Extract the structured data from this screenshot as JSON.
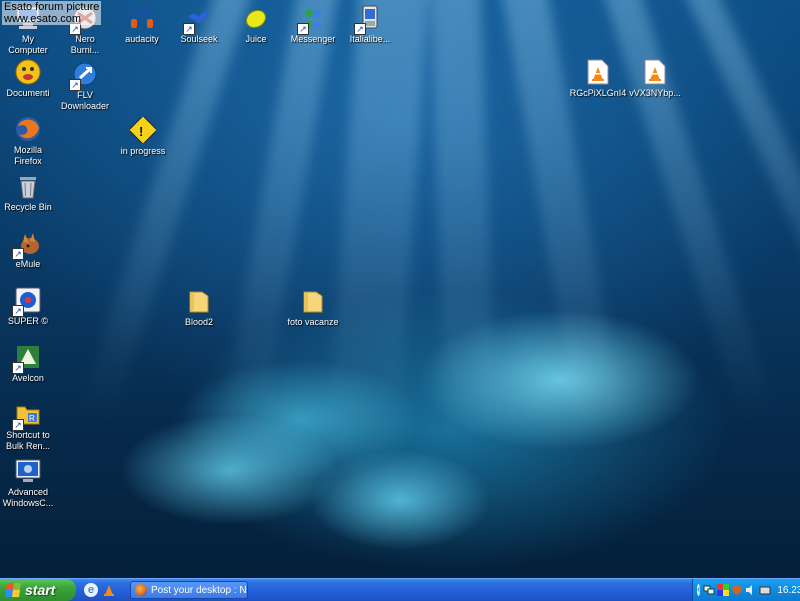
{
  "watermark": {
    "line1": "Esato forum picture",
    "line2": "www.esato.com"
  },
  "desktop_icons": [
    {
      "id": "my-computer",
      "label": "My\nComputer",
      "icon": "computer-icon"
    },
    {
      "id": "nero",
      "label": "Nero\nBurni...",
      "icon": "nero-icon"
    },
    {
      "id": "audacity",
      "label": "audacity",
      "icon": "headphones-icon"
    },
    {
      "id": "soulseek",
      "label": "Soulseek",
      "icon": "bird-icon"
    },
    {
      "id": "juice",
      "label": "Juice",
      "icon": "lemon-icon"
    },
    {
      "id": "messenger",
      "label": "Messenger",
      "icon": "messenger-people-icon"
    },
    {
      "id": "italialibera",
      "label": "Italialibe...",
      "icon": "italialibera-icon"
    },
    {
      "id": "documenti",
      "label": "Documenti",
      "icon": "smiley-face-icon"
    },
    {
      "id": "flv-downloader",
      "label": "FLV\nDownloader",
      "icon": "flv-icon"
    },
    {
      "id": "rgcpixlgni4",
      "label": "RGcPiXLGnI4",
      "icon": "vlc-file-icon"
    },
    {
      "id": "vvx3nybp",
      "label": "vVX3NYbp...",
      "icon": "vlc-file-icon"
    },
    {
      "id": "firefox",
      "label": "Mozilla\nFirefox",
      "icon": "firefox-icon"
    },
    {
      "id": "in-progress",
      "label": "in progress",
      "icon": "warning-sign-icon"
    },
    {
      "id": "recycle-bin",
      "label": "Recycle Bin",
      "icon": "trash-icon"
    },
    {
      "id": "emule",
      "label": "eMule",
      "icon": "emule-icon"
    },
    {
      "id": "super",
      "label": "SUPER ©",
      "icon": "super-icon"
    },
    {
      "id": "blood2",
      "label": "Blood2",
      "icon": "folder-icon"
    },
    {
      "id": "foto-vacanze",
      "label": "foto vacanze",
      "icon": "folder-icon"
    },
    {
      "id": "avelcon",
      "label": "Avelcon",
      "icon": "avelcon-icon"
    },
    {
      "id": "bulk-rename",
      "label": "Shortcut to\nBulk Ren...",
      "icon": "bulk-rename-icon"
    },
    {
      "id": "advanced-windowscare",
      "label": "Advanced\nWindowsC...",
      "icon": "windowscare-icon"
    }
  ],
  "taskbar": {
    "start_label": "start",
    "quick_launch": [
      {
        "name": "ie-icon"
      },
      {
        "name": "vlc-icon"
      }
    ],
    "task_button": {
      "label": "Post your desktop : N...",
      "icon": "firefox-icon"
    },
    "tray_icons": [
      "network-icon",
      "color-display-icon",
      "shield-icon",
      "speaker-icon",
      "keyboard-icon"
    ],
    "clock": "16.23"
  },
  "colors": {
    "taskbar_blue": "#245ed6",
    "start_green": "#39a439",
    "tray_blue": "#0f8be0",
    "desktop_water": "#093a66"
  }
}
